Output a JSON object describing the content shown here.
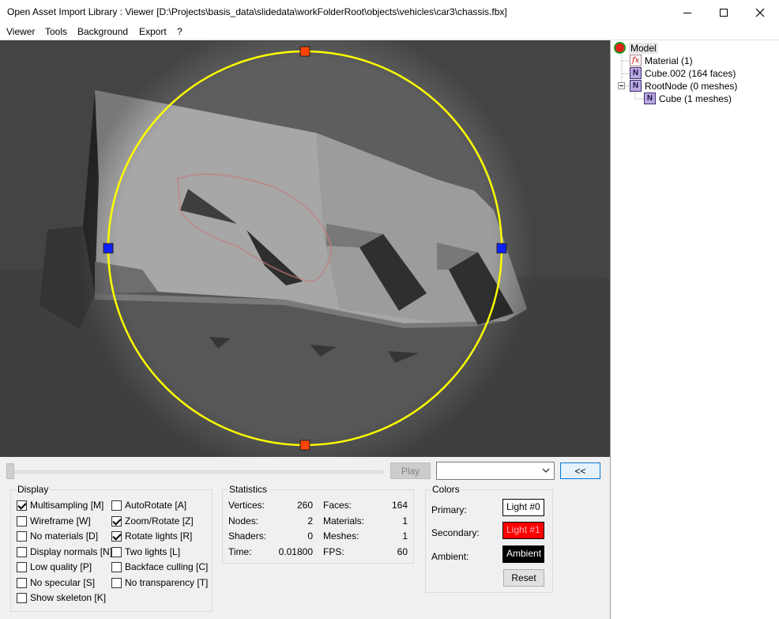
{
  "window": {
    "title": "Open Asset Import Library : Viewer  [D:\\Projects\\basis_data\\slidedata\\workFolderRoot\\objects\\vehicles\\car3\\chassis.fbx]",
    "minimize_icon": "minimize-icon",
    "maximize_icon": "maximize-icon",
    "close_icon": "close-icon"
  },
  "menu": [
    "Viewer",
    "Tools",
    "Background",
    "Export",
    "?"
  ],
  "tree": {
    "root": "Model",
    "material": "Material (1)",
    "cube002": "Cube.002 (164 faces)",
    "rootnode": "RootNode (0 meshes)",
    "cube": "Cube (1 meshes)",
    "node_badge": "N",
    "fx_badge": "fx"
  },
  "animation": {
    "play_label": "Play",
    "collapse_label": "<<",
    "combo_value": ""
  },
  "display": {
    "title": "Display",
    "options": [
      {
        "label": "Multisampling [M]",
        "checked": true
      },
      {
        "label": "Wireframe [W]",
        "checked": false
      },
      {
        "label": "No materials [D]",
        "checked": false
      },
      {
        "label": "Display normals [N]",
        "checked": false
      },
      {
        "label": "Low quality [P]",
        "checked": false
      },
      {
        "label": "No specular [S]",
        "checked": false
      },
      {
        "label": "Show skeleton [K]",
        "checked": false
      },
      {
        "label": "AutoRotate [A]",
        "checked": false
      },
      {
        "label": "Zoom/Rotate [Z]",
        "checked": true
      },
      {
        "label": "Rotate lights [R]",
        "checked": true
      },
      {
        "label": "Two lights [L]",
        "checked": false
      },
      {
        "label": "Backface culling [C]",
        "checked": false
      },
      {
        "label": "No transparency [T]",
        "checked": false
      }
    ]
  },
  "statistics": {
    "title": "Statistics",
    "vertices_label": "Vertices:",
    "vertices": "260",
    "nodes_label": "Nodes:",
    "nodes": "2",
    "shaders_label": "Shaders:",
    "shaders": "0",
    "time_label": "Time:",
    "time": "0.01800",
    "faces_label": "Faces:",
    "faces": "164",
    "materials_label": "Materials:",
    "materials": "1",
    "meshes_label": "Meshes:",
    "meshes": "1",
    "fps_label": "FPS:",
    "fps": "60"
  },
  "colors": {
    "title": "Colors",
    "primary_label": "Primary:",
    "primary_value": "Light #0",
    "primary_color": "#ffffff",
    "secondary_label": "Secondary:",
    "secondary_value": "Light #1",
    "secondary_color": "#ff0000",
    "ambient_label": "Ambient:",
    "ambient_value": "Ambient",
    "ambient_color": "#000000",
    "reset_label": "Reset"
  }
}
